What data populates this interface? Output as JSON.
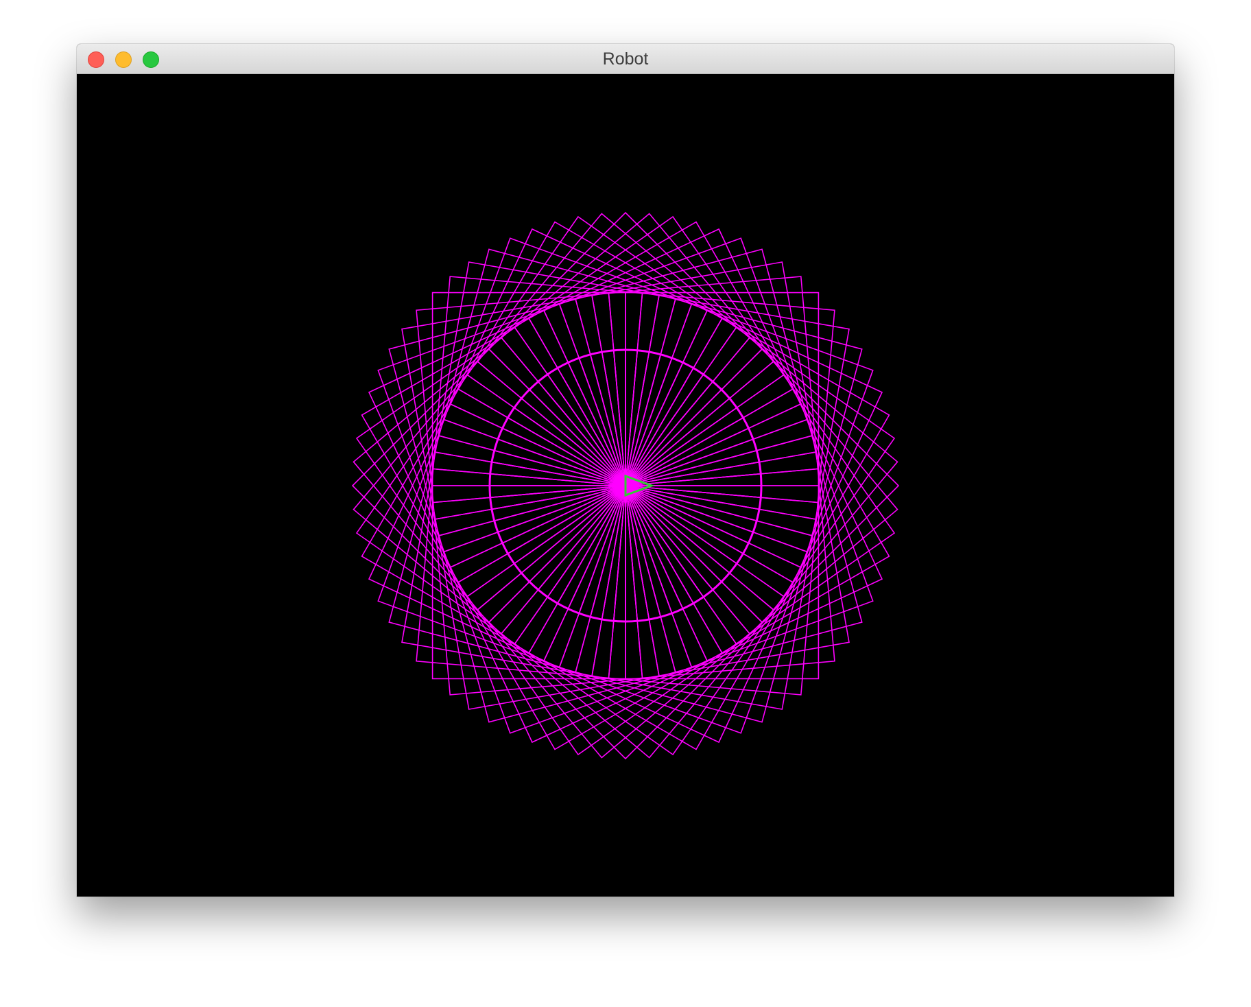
{
  "window": {
    "title": "Robot"
  },
  "canvas": {
    "background": "#000000",
    "pattern_color": "#ff00ff",
    "robot_color": "#33cc33",
    "icons": {
      "robot": "triangle-arrow-icon"
    }
  }
}
